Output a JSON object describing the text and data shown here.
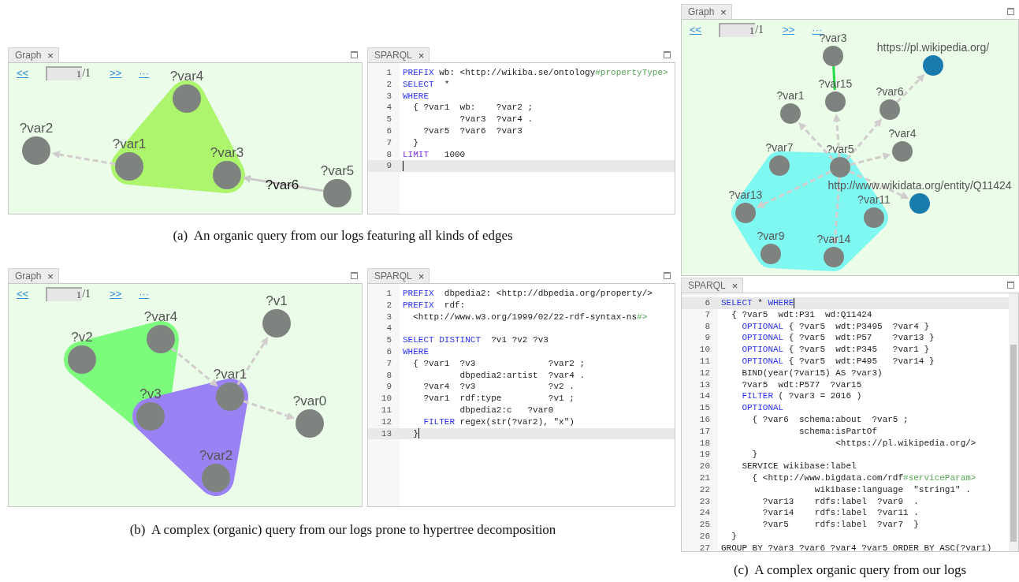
{
  "figures": [
    {
      "caption": "(a)  An organic query from our logs featuring all kinds of edges",
      "graph": {
        "tab": "Graph",
        "close": "×",
        "pager": {
          "prev": "<<",
          "page": "1",
          "total": "/1",
          "next": ">>",
          "more": "···"
        },
        "nodes": [
          {
            "label": "?var4",
            "kind": "variable"
          },
          {
            "label": "?var2",
            "kind": "variable"
          },
          {
            "label": "?var1",
            "kind": "variable"
          },
          {
            "label": "?var3",
            "kind": "variable"
          },
          {
            "label": "?var5",
            "kind": "variable"
          }
        ],
        "edges": [
          {
            "kind": "dashed"
          },
          {
            "kind": "solid",
            "label": "?var6"
          }
        ],
        "hyperedges": [
          {
            "color": "#adf56c"
          }
        ]
      },
      "sparql": {
        "tab": "SPARQL",
        "close": "×",
        "lines": [
          {
            "number": "1",
            "current": false,
            "segments": [
              {
                "kind": "keyword",
                "text": "PREFIX"
              },
              {
                "kind": "plain",
                "text": " wb: <http://wikiba.se/ontology"
              },
              {
                "kind": "fragment",
                "text": "#propertyType>"
              }
            ]
          },
          {
            "number": "2",
            "current": false,
            "segments": [
              {
                "kind": "keyword",
                "text": "SELECT"
              },
              {
                "kind": "plain",
                "text": "  *"
              }
            ]
          },
          {
            "number": "3",
            "current": false,
            "segments": [
              {
                "kind": "keyword",
                "text": "WHERE"
              }
            ]
          },
          {
            "number": "4",
            "current": false,
            "segments": [
              {
                "kind": "plain",
                "text": "  { ?var1  wb:    ?var2 ;"
              }
            ]
          },
          {
            "number": "5",
            "current": false,
            "segments": [
              {
                "kind": "plain",
                "text": "           ?var3  ?var4 ."
              }
            ]
          },
          {
            "number": "6",
            "current": false,
            "segments": [
              {
                "kind": "plain",
                "text": "    ?var5  ?var6  ?var3"
              }
            ]
          },
          {
            "number": "7",
            "current": false,
            "segments": [
              {
                "kind": "plain",
                "text": "  }"
              }
            ]
          },
          {
            "number": "8",
            "current": false,
            "segments": [
              {
                "kind": "modifier",
                "text": "LIMIT"
              },
              {
                "kind": "plain",
                "text": "   1000"
              }
            ]
          },
          {
            "number": "9",
            "current": true
          }
        ]
      }
    },
    {
      "caption": "(b)  A complex (organic) query from our logs prone to hypertree decomposition",
      "graph": {
        "tab": "Graph",
        "close": "×",
        "pager": {
          "prev": "<<",
          "page": "1",
          "total": "/1",
          "next": ">>",
          "more": "···"
        },
        "nodes": [
          {
            "label": "?v1",
            "kind": "variable"
          },
          {
            "label": "?var4",
            "kind": "variable"
          },
          {
            "label": "?v2",
            "kind": "variable"
          },
          {
            "label": "?var1",
            "kind": "variable"
          },
          {
            "label": "?v3",
            "kind": "variable"
          },
          {
            "label": "?var0",
            "kind": "variable"
          },
          {
            "label": "?var2",
            "kind": "variable"
          }
        ],
        "edges": [
          {
            "kind": "dashed"
          },
          {
            "kind": "dashed"
          },
          {
            "kind": "dashed"
          }
        ],
        "hyperedges": [
          {
            "color": "#7cfb7c"
          },
          {
            "color": "#9b82f4"
          }
        ]
      },
      "sparql": {
        "tab": "SPARQL",
        "close": "×",
        "lines": [
          {
            "number": "1",
            "current": false,
            "segments": [
              {
                "kind": "keyword",
                "text": "PREFIX"
              },
              {
                "kind": "plain",
                "text": "  dbpedia2: <http://dbpedia.org/property/>"
              }
            ]
          },
          {
            "number": "2",
            "current": false,
            "segments": [
              {
                "kind": "keyword",
                "text": "PREFIX"
              },
              {
                "kind": "plain",
                "text": "  rdf:"
              }
            ]
          },
          {
            "number": "3",
            "current": false,
            "segments": [
              {
                "kind": "plain",
                "text": "  <http://www.w3.org/1999/02/22-rdf-syntax-ns"
              },
              {
                "kind": "fragment",
                "text": "#>"
              }
            ]
          },
          {
            "number": "4",
            "current": false
          },
          {
            "number": "5",
            "current": false,
            "segments": [
              {
                "kind": "keyword",
                "text": "SELECT DISTINCT"
              },
              {
                "kind": "plain",
                "text": "  ?v1 ?v2 ?v3"
              }
            ]
          },
          {
            "number": "6",
            "current": false,
            "segments": [
              {
                "kind": "keyword",
                "text": "WHERE"
              }
            ]
          },
          {
            "number": "7",
            "current": false,
            "segments": [
              {
                "kind": "plain",
                "text": "  { ?var1  ?v3              ?var2 ;"
              }
            ]
          },
          {
            "number": "8",
            "current": false,
            "segments": [
              {
                "kind": "plain",
                "text": "           dbpedia2:artist  ?var4 ."
              }
            ]
          },
          {
            "number": "9",
            "current": false,
            "segments": [
              {
                "kind": "plain",
                "text": "    ?var4  ?v3              ?v2 ."
              }
            ]
          },
          {
            "number": "10",
            "current": false,
            "segments": [
              {
                "kind": "plain",
                "text": "    ?var1  rdf:type         ?v1 ;"
              }
            ]
          },
          {
            "number": "11",
            "current": false,
            "segments": [
              {
                "kind": "plain",
                "text": "           dbpedia2:c   ?var0"
              }
            ]
          },
          {
            "number": "12",
            "current": false,
            "segments": [
              {
                "kind": "keyword",
                "text": "    FILTER"
              },
              {
                "kind": "plain",
                "text": " regex(str(?var2), \"x\")"
              }
            ]
          },
          {
            "number": "13",
            "current": true,
            "segments": [
              {
                "kind": "plain",
                "text": "  }"
              }
            ]
          }
        ]
      }
    },
    {
      "caption": "(c)  A complex organic query from our logs",
      "graph": {
        "tab": "Graph",
        "close": "×",
        "pager": {
          "prev": "<<",
          "page": "1",
          "total": "/1",
          "next": ">>",
          "more": "···"
        },
        "nodes": [
          {
            "label": "?var3",
            "kind": "variable"
          },
          {
            "label": "https://pl.wikipedia.org/",
            "kind": "iri"
          },
          {
            "label": "?var15",
            "kind": "variable"
          },
          {
            "label": "?var6",
            "kind": "variable"
          },
          {
            "label": "?var1",
            "kind": "variable"
          },
          {
            "label": "?var4",
            "kind": "variable"
          },
          {
            "label": "?var7",
            "kind": "variable"
          },
          {
            "label": "?var5",
            "kind": "variable"
          },
          {
            "label": "http://www.wikidata.org/entity/Q11424",
            "kind": "iri"
          },
          {
            "label": "?var13",
            "kind": "variable"
          },
          {
            "label": "?var11",
            "kind": "variable"
          },
          {
            "label": "?var9",
            "kind": "variable"
          },
          {
            "label": "?var14",
            "kind": "variable"
          }
        ],
        "edges": [
          {
            "kind": "highlighted"
          },
          {
            "kind": "dashed"
          },
          {
            "kind": "dashed"
          },
          {
            "kind": "dashed"
          },
          {
            "kind": "dashed"
          },
          {
            "kind": "dashed"
          },
          {
            "kind": "dashed"
          },
          {
            "kind": "dashed"
          },
          {
            "kind": "dashed"
          }
        ],
        "hyperedges": [
          {
            "color": "#80f8f2"
          }
        ]
      },
      "sparql": {
        "tab": "SPARQL",
        "close": "×",
        "lines": [
          {
            "number": "6",
            "current": true,
            "segments": [
              {
                "kind": "keyword",
                "text": "SELECT"
              },
              {
                "kind": "plain",
                "text": " * "
              },
              {
                "kind": "keyword",
                "text": "WHERE"
              }
            ]
          },
          {
            "number": "7",
            "current": false,
            "segments": [
              {
                "kind": "plain",
                "text": "  { ?var5  wdt:P31  wd:Q11424"
              }
            ]
          },
          {
            "number": "8",
            "current": false,
            "segments": [
              {
                "kind": "keyword",
                "text": "    OPTIONAL"
              },
              {
                "kind": "plain",
                "text": " { ?var5  wdt:P3495  ?var4 }"
              }
            ]
          },
          {
            "number": "9",
            "current": false,
            "segments": [
              {
                "kind": "keyword",
                "text": "    OPTIONAL"
              },
              {
                "kind": "plain",
                "text": " { ?var5  wdt:P57    ?var13 }"
              }
            ]
          },
          {
            "number": "10",
            "current": false,
            "segments": [
              {
                "kind": "keyword",
                "text": "    OPTIONAL"
              },
              {
                "kind": "plain",
                "text": " { ?var5  wdt:P345   ?var1 }"
              }
            ]
          },
          {
            "number": "11",
            "current": false,
            "segments": [
              {
                "kind": "keyword",
                "text": "    OPTIONAL"
              },
              {
                "kind": "plain",
                "text": " { ?var5  wdt:P495   ?var14 }"
              }
            ]
          },
          {
            "number": "12",
            "current": false,
            "segments": [
              {
                "kind": "plain",
                "text": "    BIND(year(?var15) AS ?var3)"
              }
            ]
          },
          {
            "number": "13",
            "current": false,
            "segments": [
              {
                "kind": "plain",
                "text": "    ?var5  wdt:P577  ?var15"
              }
            ]
          },
          {
            "number": "14",
            "current": false,
            "segments": [
              {
                "kind": "keyword",
                "text": "    FILTER"
              },
              {
                "kind": "plain",
                "text": " ( ?var3 = 2016 )"
              }
            ]
          },
          {
            "number": "15",
            "current": false,
            "segments": [
              {
                "kind": "keyword",
                "text": "    OPTIONAL"
              }
            ]
          },
          {
            "number": "16",
            "current": false,
            "segments": [
              {
                "kind": "plain",
                "text": "      { ?var6  schema:about  ?var5 ;"
              }
            ]
          },
          {
            "number": "17",
            "current": false,
            "segments": [
              {
                "kind": "plain",
                "text": "               schema:isPartOf"
              }
            ]
          },
          {
            "number": "18",
            "current": false,
            "segments": [
              {
                "kind": "plain",
                "text": "                      <https://pl.wikipedia.org/>"
              }
            ]
          },
          {
            "number": "19",
            "current": false,
            "segments": [
              {
                "kind": "plain",
                "text": "      }"
              }
            ]
          },
          {
            "number": "20",
            "current": false,
            "segments": [
              {
                "kind": "plain",
                "text": "    SERVICE wikibase:label"
              }
            ]
          },
          {
            "number": "21",
            "current": false,
            "segments": [
              {
                "kind": "plain",
                "text": "      { <http://www.bigdata.com/rdf"
              },
              {
                "kind": "fragment",
                "text": "#serviceParam>"
              }
            ]
          },
          {
            "number": "22",
            "current": false,
            "segments": [
              {
                "kind": "plain",
                "text": "                  wikibase:language  \"string1\" ."
              }
            ]
          },
          {
            "number": "23",
            "current": false,
            "segments": [
              {
                "kind": "plain",
                "text": "        ?var13    rdfs:label  ?var9  ."
              }
            ]
          },
          {
            "number": "24",
            "current": false,
            "segments": [
              {
                "kind": "plain",
                "text": "        ?var14    rdfs:label  ?var11 ."
              }
            ]
          },
          {
            "number": "25",
            "current": false,
            "segments": [
              {
                "kind": "plain",
                "text": "        ?var5     rdfs:label  ?var7  }"
              }
            ]
          },
          {
            "number": "26",
            "current": false,
            "segments": [
              {
                "kind": "plain",
                "text": "  }"
              }
            ]
          },
          {
            "number": "27",
            "current": false,
            "segments": [
              {
                "kind": "plain",
                "text": "GROUP BY ?var3 ?var6 ?var4 ?var5 ORDER BY ASC(?var1)"
              }
            ]
          }
        ]
      }
    }
  ]
}
